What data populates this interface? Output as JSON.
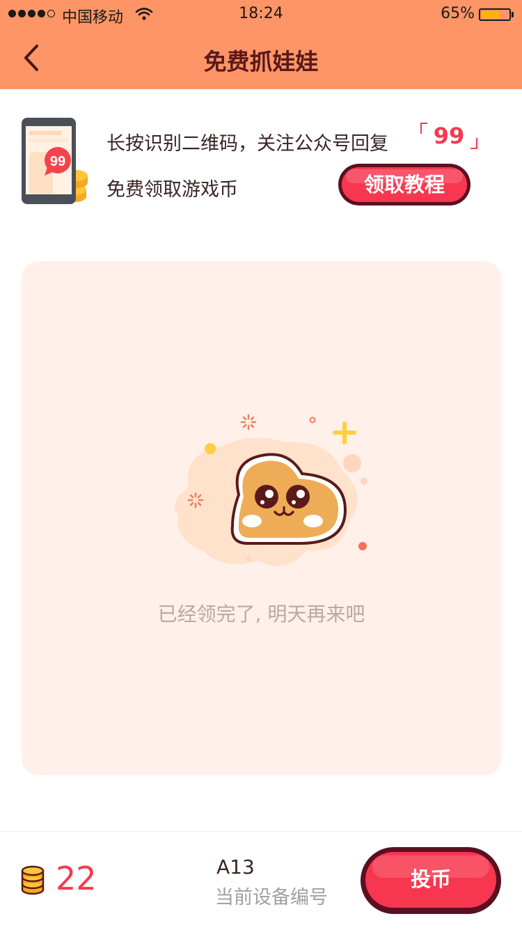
{
  "status_bar": {
    "carrier": "中国移动",
    "time": "18:24",
    "battery_percent": "65%",
    "battery_level": 0.65,
    "signal_bars": 4,
    "signal_max": 5
  },
  "nav": {
    "title": "免费抓娃娃",
    "back_icon": "chevron-left-icon"
  },
  "promo": {
    "line1": "长按识别二维码，关注公众号回复",
    "code": "99",
    "line2": "免费领取游戏币",
    "tutorial_button_label": "领取教程",
    "badge_text": "99"
  },
  "empty_state": {
    "message": "已经领完了, 明天再来吧"
  },
  "bottom": {
    "coin_count": "22",
    "device_code": "A13",
    "device_label": "当前设备编号",
    "insert_coin_label": "投币"
  },
  "colors": {
    "header_bg": "#fd9566",
    "accent_red": "#f53a4e",
    "button_outline": "#5a1022",
    "card_bg": "#fff0ea",
    "title_color": "#5a1a1a"
  }
}
